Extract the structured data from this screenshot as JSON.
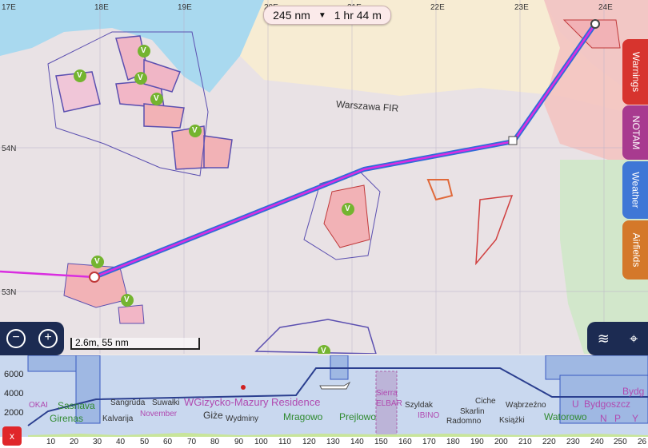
{
  "route_pill": {
    "distance": "245 nm",
    "duration": "1 hr 44 m"
  },
  "map": {
    "longitude_labels": [
      "17E",
      "18E",
      "19E",
      "20E",
      "21E",
      "22E",
      "23E",
      "24E"
    ],
    "latitude_labels": [
      "54N",
      "53N"
    ],
    "fir_label": "Warszawa FIR",
    "waypoint_marker": "V"
  },
  "side_tabs": [
    "Warnings",
    "NOTAM",
    "Weather",
    "Airfields"
  ],
  "scale_bar": "2.6m, 55 nm",
  "profile": {
    "y_axis": [
      "6000",
      "4000",
      "2000"
    ],
    "x_axis": [
      "10",
      "20",
      "30",
      "40",
      "50",
      "60",
      "70",
      "80",
      "90",
      "100",
      "110",
      "120",
      "130",
      "140",
      "150",
      "160",
      "170",
      "180",
      "190",
      "200",
      "210",
      "220",
      "230",
      "240",
      "250",
      "26"
    ],
    "places": [
      {
        "text": "OKAI",
        "color": "#b04ab0"
      },
      {
        "text": "Sasnava",
        "color": "#2f8a2f"
      },
      {
        "text": "Girenas",
        "color": "#2f8a2f"
      },
      {
        "text": "Sangrūda",
        "color": "#333"
      },
      {
        "text": "Suwałki",
        "color": "#333"
      },
      {
        "text": "WGizycko-Mazury Residence",
        "color": "#b04ab0"
      },
      {
        "text": "Kalvarija",
        "color": "#333"
      },
      {
        "text": "November",
        "color": "#b04ab0"
      },
      {
        "text": "Giże",
        "color": "#333"
      },
      {
        "text": "Wydminy",
        "color": "#333"
      },
      {
        "text": "Mragowo",
        "color": "#2f8a2f"
      },
      {
        "text": "Prejlowo",
        "color": "#2f8a2f"
      },
      {
        "text": "Sierra",
        "color": "#b04ab0"
      },
      {
        "text": "ELBAR",
        "color": "#b04ab0"
      },
      {
        "text": "Szyldak",
        "color": "#333"
      },
      {
        "text": "IBINO",
        "color": "#b04ab0"
      },
      {
        "text": "Radomno",
        "color": "#333"
      },
      {
        "text": "Skarlin",
        "color": "#333"
      },
      {
        "text": "Ciche",
        "color": "#333"
      },
      {
        "text": "Wąbrzeźno",
        "color": "#333"
      },
      {
        "text": "Książki",
        "color": "#333"
      },
      {
        "text": "Watorowo",
        "color": "#2f8a2f"
      },
      {
        "text": "U",
        "color": "#b04ab0"
      },
      {
        "text": "Bydgoszcz",
        "color": "#b04ab0"
      },
      {
        "text": "N",
        "color": "#b04ab0"
      },
      {
        "text": "P",
        "color": "#b04ab0"
      },
      {
        "text": "Bydg",
        "color": "#b04ab0"
      },
      {
        "text": "Y",
        "color": "#b04ab0"
      }
    ]
  },
  "close_button": "x",
  "colors": {
    "route": "#d92ee0",
    "route_outline": "#2f6bd8",
    "warnings": "#d7342e",
    "notam": "#a83a8f",
    "weather": "#3f77d6",
    "airfields": "#d4782a"
  }
}
